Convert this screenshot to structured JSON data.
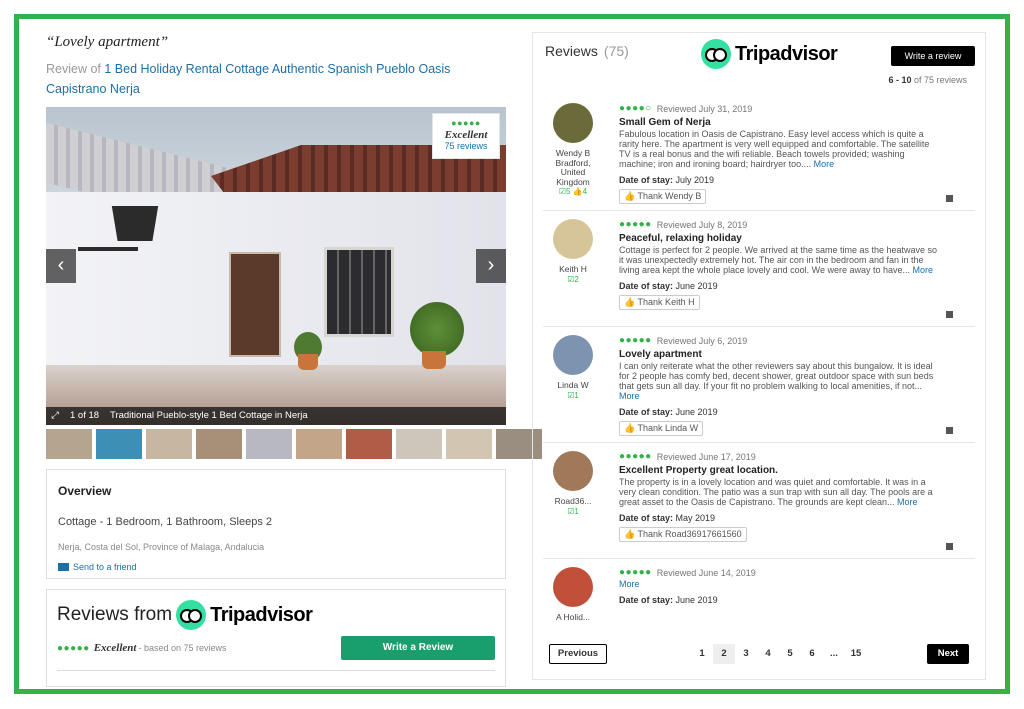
{
  "left": {
    "quote": "“Lovely apartment”",
    "review_of_prefix": "Review of",
    "review_of_link": "1 Bed Holiday Rental Cottage Authentic Spanish Pueblo Oasis Capistrano Nerja",
    "hero": {
      "rating_word": "Excellent",
      "rating_reviews": "75 reviews",
      "rating_dots": "●●●●●",
      "counter": "1 of 18",
      "caption": "Traditional Pueblo-style 1 Bed Cottage in Nerja",
      "prev_glyph": "‹",
      "next_glyph": "›",
      "expand_glyph": "⤢"
    },
    "thumb_colors": [
      "#b5a58f",
      "#3e8fb5",
      "#c8b7a0",
      "#a89078",
      "#b8b8c2",
      "#c3a689",
      "#b15c46",
      "#cfc6bb",
      "#d2c5b2",
      "#9a8e80"
    ],
    "overview": {
      "title": "Overview",
      "type": "Cottage - 1 Bedroom, 1 Bathroom, Sleeps 2",
      "location": "Nerja, Costa del Sol, Province of Malaga, Andalucia",
      "send": "Send to a friend"
    },
    "reviews_from": {
      "title": "Reviews from",
      "brand": "Tripadvisor",
      "dots": "●●●●●",
      "excellent": "Excellent",
      "based": "- based on 75 reviews",
      "button": "Write a Review"
    }
  },
  "right": {
    "title": "Reviews",
    "count": "(75)",
    "brand": "Tripadvisor",
    "write_button": "Write a review",
    "range_bold": "6 - 10",
    "range_rest": "of 75 reviews",
    "reviews": [
      {
        "user": "Wendy B Bradford, United Kingdom",
        "contrib": "☑5 👍4",
        "avatar": "#6b6a3a",
        "dots": "●●●●○",
        "date": "Reviewed July 31, 2019",
        "title": "Small Gem of Nerja",
        "text": "Fabulous location in Oasis de Capistrano. Easy level access which is quite a rarity here. The apartment is very well equipped and comfortable. The satellite TV is a real bonus and the wifi reliable. Beach towels provided; washing machine; iron and ironing board; hairdryer too....",
        "more": "More",
        "stay_label": "Date of stay:",
        "stay": "July 2019",
        "thank": "Thank Wendy B"
      },
      {
        "user": "Keith H",
        "contrib": "☑2",
        "avatar": "#d7c59a",
        "dots": "●●●●●",
        "date": "Reviewed July 8, 2019",
        "title": "Peaceful, relaxing holiday",
        "text": "Cottage is perfect for 2 people. We arrived at the same time as the heatwave so it was unexpectedly extremely hot. The air con in the bedroom and fan in the living area kept the whole place lovely and cool. We were away to have...",
        "more": "More",
        "stay_label": "Date of stay:",
        "stay": "June 2019",
        "thank": "Thank Keith H"
      },
      {
        "user": "Linda W",
        "contrib": "☑1",
        "avatar": "#7d93b0",
        "dots": "●●●●●",
        "date": "Reviewed July 6, 2019",
        "title": "Lovely apartment",
        "text": "I can only reiterate what the other reviewers say about this bungalow. It is ideal for 2 people has comfy bed, decent shower, great outdoor space with sun beds that gets sun all day. If your fit no problem walking to local amenities, if not...",
        "more": "More",
        "stay_label": "Date of stay:",
        "stay": "June 2019",
        "thank": "Thank Linda W"
      },
      {
        "user": "Road36...",
        "contrib": "☑1",
        "avatar": "#a0785a",
        "dots": "●●●●●",
        "date": "Reviewed June 17, 2019",
        "title": "Excellent Property great location.",
        "text": "The property is in a lovely location and was quiet and comfortable. It was in a very clean condition. The patio was a sun trap with sun all day. The pools are a great asset to the Oasis de Capistrano. The grounds are kept clean...",
        "more": "More",
        "stay_label": "Date of stay:",
        "stay": "May 2019",
        "thank": "Thank Road36917661560"
      },
      {
        "user": "A Holid...",
        "contrib": "",
        "avatar": "#c0503a",
        "dots": "●●●●●",
        "date": "Reviewed June 14, 2019",
        "title": "",
        "text": "",
        "more": "More",
        "stay_label": "Date of stay:",
        "stay": "June 2019",
        "thank": ""
      }
    ],
    "pager": {
      "prev": "Previous",
      "pages": [
        "1",
        "2",
        "3",
        "4",
        "5",
        "6",
        "...",
        "15"
      ],
      "current": "2",
      "next": "Next"
    }
  }
}
